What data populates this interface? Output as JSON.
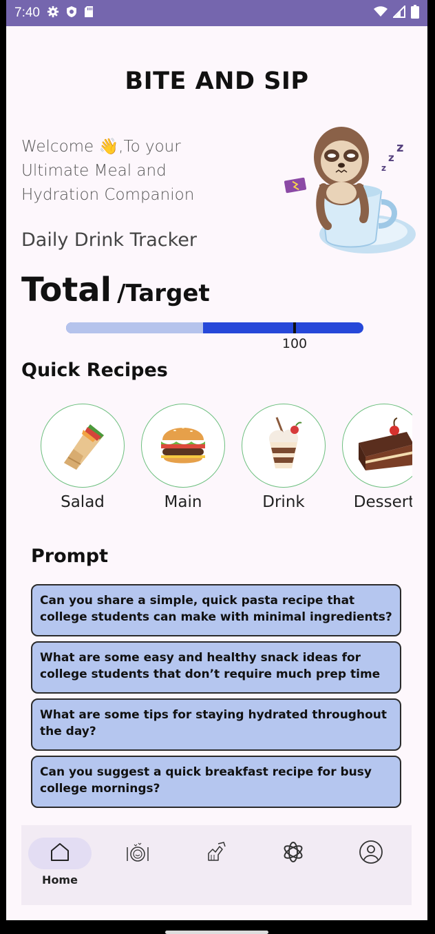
{
  "status_bar": {
    "time": "7:40",
    "left_icons": [
      "settings-icon",
      "shield-icon",
      "sd-card-icon"
    ],
    "right_icons": [
      "wifi-icon",
      "signal-icon",
      "battery-icon"
    ],
    "background": "#7566ae"
  },
  "app": {
    "title": "BITE AND SIP"
  },
  "hero": {
    "welcome_text": "Welcome 👋,To your Ultimate Meal and Hydration Companion",
    "illustration": "sleeping-sloth-in-cup-illustration"
  },
  "tracker": {
    "label": "Daily Drink Tracker",
    "total_label": "Total",
    "target_label": "/Target",
    "progress_fraction": 0.46,
    "target_value": "100",
    "colors": {
      "filled": "#b5c3ec",
      "remaining": "#2648d9"
    }
  },
  "quick_recipes": {
    "title": "Quick Recipes",
    "items": [
      {
        "label": "Salad",
        "icon": "wrap-icon"
      },
      {
        "label": "Main",
        "icon": "burger-icon"
      },
      {
        "label": "Drink",
        "icon": "milkshake-icon"
      },
      {
        "label": "Dessert",
        "icon": "cake-icon"
      }
    ]
  },
  "prompts": {
    "title": "Prompt",
    "items": [
      "Can you share a simple, quick pasta recipe that college students can make with minimal ingredients?",
      "What are some easy and healthy snack ideas for college students that don’t require much prep time",
      "What are some tips for staying hydrated throughout the day?",
      "Can you suggest a quick breakfast recipe for busy college mornings?"
    ],
    "card_color": "#b5c6ef"
  },
  "bottom_nav": {
    "items": [
      {
        "label": "Home",
        "icon": "home-icon",
        "active": true
      },
      {
        "label": "",
        "icon": "meal-plate-icon",
        "active": false
      },
      {
        "label": "",
        "icon": "cooking-hand-icon",
        "active": false
      },
      {
        "label": "",
        "icon": "ai-chat-icon",
        "active": false
      },
      {
        "label": "",
        "icon": "profile-icon",
        "active": false
      }
    ]
  }
}
